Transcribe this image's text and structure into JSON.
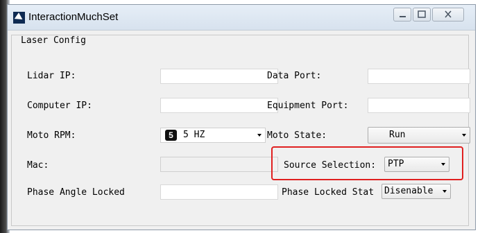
{
  "window": {
    "title": "InteractionMuchSet"
  },
  "group": {
    "title": "Laser Config"
  },
  "labels": {
    "lidar_ip": "Lidar IP:",
    "data_port": "Data Port:",
    "computer_ip": "Computer IP:",
    "equipment_port": "Equipment Port:",
    "moto_rpm": "Moto RPM:",
    "moto_state": "Moto State:",
    "mac": "Mac:",
    "source_selection": "Source Selection:",
    "phase_angle_locked": "Phase Angle Locked",
    "phase_locked_stat": "Phase Locked Stat"
  },
  "moto_rpm": {
    "badge": "5",
    "value": "5 HZ"
  },
  "moto_state": {
    "value": "Run"
  },
  "source_selection": {
    "value": "PTP"
  },
  "phase_locked_stat": {
    "value": "Disenable"
  },
  "inputs": {
    "lidar_ip": "",
    "data_port": "",
    "computer_ip": "",
    "equipment_port": "",
    "mac": "",
    "phase_angle_locked": ""
  },
  "accent": {
    "highlight": "#e02020",
    "title_bg": "#dce6f1"
  },
  "icons": {
    "app": "app-icon",
    "minimize": "minimize-icon",
    "maximize": "maximize-icon",
    "close": "close-icon"
  }
}
